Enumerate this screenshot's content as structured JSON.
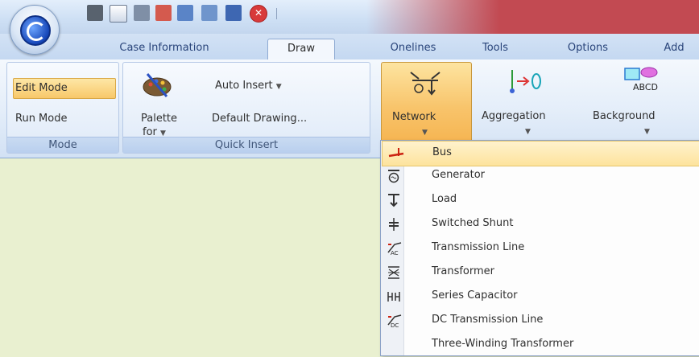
{
  "quick_access": [
    "save-icon",
    "spell-icon",
    "clipboard-icon",
    "grid-icon",
    "table-icon",
    "chart-icon",
    "window-icon",
    "close-icon"
  ],
  "tabs": [
    {
      "label": "Case Information"
    },
    {
      "label": "Draw"
    },
    {
      "label": "Onelines"
    },
    {
      "label": "Tools"
    },
    {
      "label": "Options"
    },
    {
      "label": "Add"
    }
  ],
  "ribbon": {
    "mode": {
      "edit": "Edit Mode",
      "run": "Run Mode",
      "label": "Mode"
    },
    "quick_insert": {
      "palette": "Palette",
      "palette_for": "for",
      "auto_insert": "Auto Insert",
      "default_drawing": "Default Drawing...",
      "label": "Quick Insert"
    },
    "network": "Network",
    "aggregation": "Aggregation",
    "background": "Background"
  },
  "menu": {
    "items": [
      {
        "label": "Bus",
        "icon": "bus-icon"
      },
      {
        "label": "Generator",
        "icon": "generator-icon"
      },
      {
        "label": "Load",
        "icon": "load-icon"
      },
      {
        "label": "Switched Shunt",
        "icon": "switched-shunt-icon"
      },
      {
        "label": "Transmission Line",
        "icon": "ac-line-icon"
      },
      {
        "label": "Transformer",
        "icon": "transformer-icon"
      },
      {
        "label": "Series Capacitor",
        "icon": "series-capacitor-icon"
      },
      {
        "label": "DC Transmission Line",
        "icon": "dc-line-icon"
      },
      {
        "label": "Three-Winding Transformer",
        "icon": ""
      }
    ]
  },
  "colors": {
    "accent": "#f8c86a",
    "ribbon_bg": "#dfeaf8",
    "title_red": "#c24a52",
    "canvas": "#e9f0d0"
  }
}
